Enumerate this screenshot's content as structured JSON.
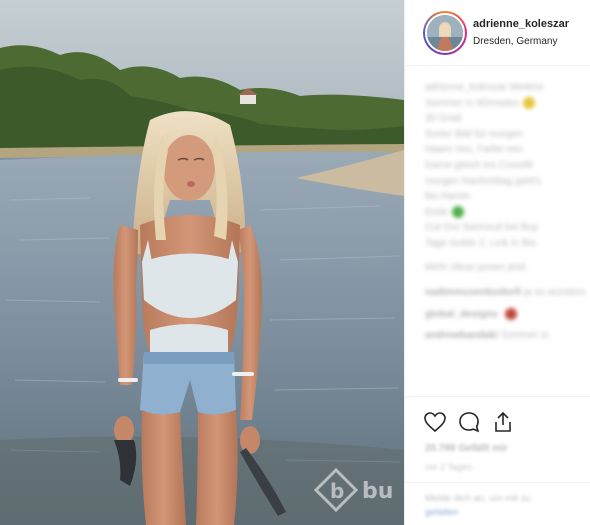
{
  "post": {
    "username": "adrienne_koleszar",
    "location": "Dresden, Germany"
  },
  "caption": {
    "lines": [
      "adrienne_koleszar Weitere",
      "Sommer in #Dresden",
      "30 Grad",
      "Sorter Bild für morgen",
      "Haare neu, Farbe neu",
      "Dame gleich ins Crossfit",
      "morgen Nachmittag geht's",
      "bis Hamm",
      "Ende",
      "Cut Out Swimsuit bei Buy",
      "Tage Golde 2, Link in Bio"
    ],
    "more_link": "Mehr Ideas posen jetzt"
  },
  "comments": [
    {
      "user": "nadimmusenbodorfi",
      "text": "ja so wunderschön"
    },
    {
      "user": "global_designs",
      "text": ""
    },
    {
      "user": "andrewbandaki",
      "text": "Sommer in"
    }
  ],
  "stats": {
    "likes": "20.788 Gefällt mir",
    "time": "vor 2 Tagen"
  },
  "login_prompt": {
    "text": "Melde dich an, um mit zu",
    "link": "gefallen"
  },
  "icons": [
    "heart-icon",
    "comment-icon",
    "share-icon"
  ],
  "watermark": "bu",
  "colors": {
    "sky": "#b7c6cf",
    "river": "#7f93a4",
    "trees": "#4c6a32",
    "story_ring": "#dd2a7b"
  }
}
